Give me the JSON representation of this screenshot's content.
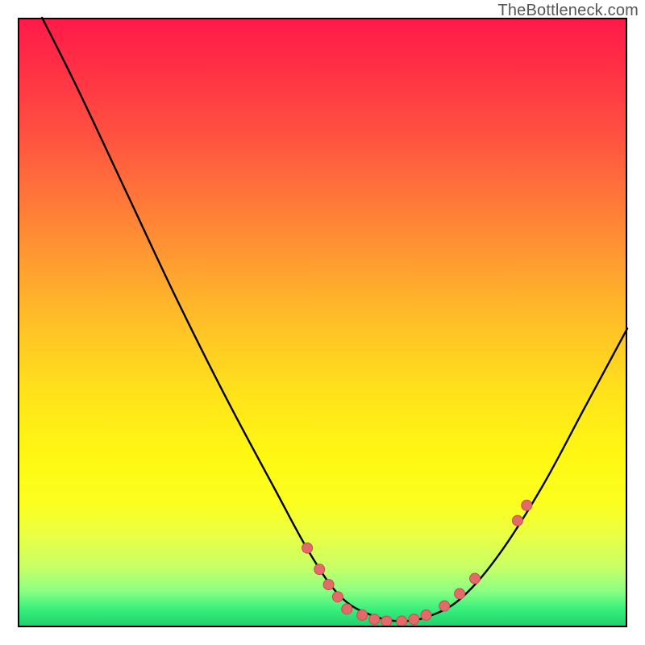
{
  "attribution": "TheBottleneck.com",
  "chart_data": {
    "type": "line",
    "title": "",
    "xlabel": "",
    "ylabel": "",
    "xlim": [
      0,
      100
    ],
    "ylim": [
      0,
      100
    ],
    "curve": [
      {
        "x": 4,
        "y": 100
      },
      {
        "x": 10,
        "y": 88
      },
      {
        "x": 18,
        "y": 71
      },
      {
        "x": 26,
        "y": 54
      },
      {
        "x": 34,
        "y": 38
      },
      {
        "x": 42,
        "y": 23
      },
      {
        "x": 48,
        "y": 12
      },
      {
        "x": 53,
        "y": 5
      },
      {
        "x": 58,
        "y": 2
      },
      {
        "x": 63,
        "y": 1
      },
      {
        "x": 68,
        "y": 2
      },
      {
        "x": 73,
        "y": 5
      },
      {
        "x": 79,
        "y": 12
      },
      {
        "x": 86,
        "y": 23
      },
      {
        "x": 93,
        "y": 36
      },
      {
        "x": 100,
        "y": 49
      }
    ],
    "highlight_points": [
      {
        "x": 47.5,
        "y": 13.0
      },
      {
        "x": 49.5,
        "y": 9.5
      },
      {
        "x": 51.0,
        "y": 7.0
      },
      {
        "x": 52.5,
        "y": 5.0
      },
      {
        "x": 54.0,
        "y": 3.0
      },
      {
        "x": 56.5,
        "y": 2.0
      },
      {
        "x": 58.5,
        "y": 1.3
      },
      {
        "x": 60.5,
        "y": 1.0
      },
      {
        "x": 63.0,
        "y": 1.0
      },
      {
        "x": 65.0,
        "y": 1.3
      },
      {
        "x": 67.0,
        "y": 2.0
      },
      {
        "x": 70.0,
        "y": 3.5
      },
      {
        "x": 72.5,
        "y": 5.5
      },
      {
        "x": 75.0,
        "y": 8.0
      },
      {
        "x": 82.0,
        "y": 17.5
      },
      {
        "x": 83.5,
        "y": 20.0
      }
    ],
    "colors": {
      "curve": "#000000",
      "point_fill": "#e46a6a",
      "point_stroke": "#c24f4f",
      "gradient_top": "#ff1a49",
      "gradient_bottom": "#1ecf6a"
    }
  }
}
